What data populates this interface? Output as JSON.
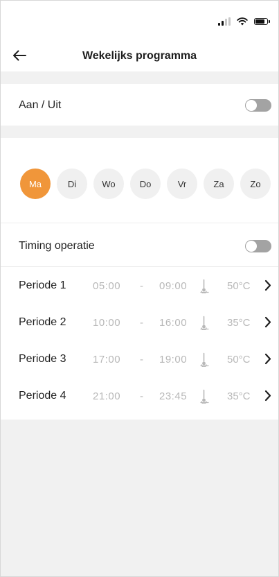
{
  "header": {
    "title": "Wekelijks programma"
  },
  "onoff": {
    "label": "Aan / Uit",
    "state": "off"
  },
  "days": [
    {
      "label": "Ma",
      "active": true
    },
    {
      "label": "Di",
      "active": false
    },
    {
      "label": "Wo",
      "active": false
    },
    {
      "label": "Do",
      "active": false
    },
    {
      "label": "Vr",
      "active": false
    },
    {
      "label": "Za",
      "active": false
    },
    {
      "label": "Zo",
      "active": false
    }
  ],
  "timing": {
    "label": "Timing operatie",
    "state": "off"
  },
  "periods": [
    {
      "label": "Periode 1",
      "start": "05:00",
      "sep": "-",
      "end": "09:00",
      "temp": "50°C"
    },
    {
      "label": "Periode 2",
      "start": "10:00",
      "sep": "-",
      "end": "16:00",
      "temp": "35°C"
    },
    {
      "label": "Periode 3",
      "start": "17:00",
      "sep": "-",
      "end": "19:00",
      "temp": "50°C"
    },
    {
      "label": "Periode 4",
      "start": "21:00",
      "sep": "-",
      "end": "23:45",
      "temp": "35°C"
    }
  ],
  "colors": {
    "accent": "#f0963a",
    "toggle_off": "#a3a3a3",
    "muted_text": "#b8b8b8"
  }
}
